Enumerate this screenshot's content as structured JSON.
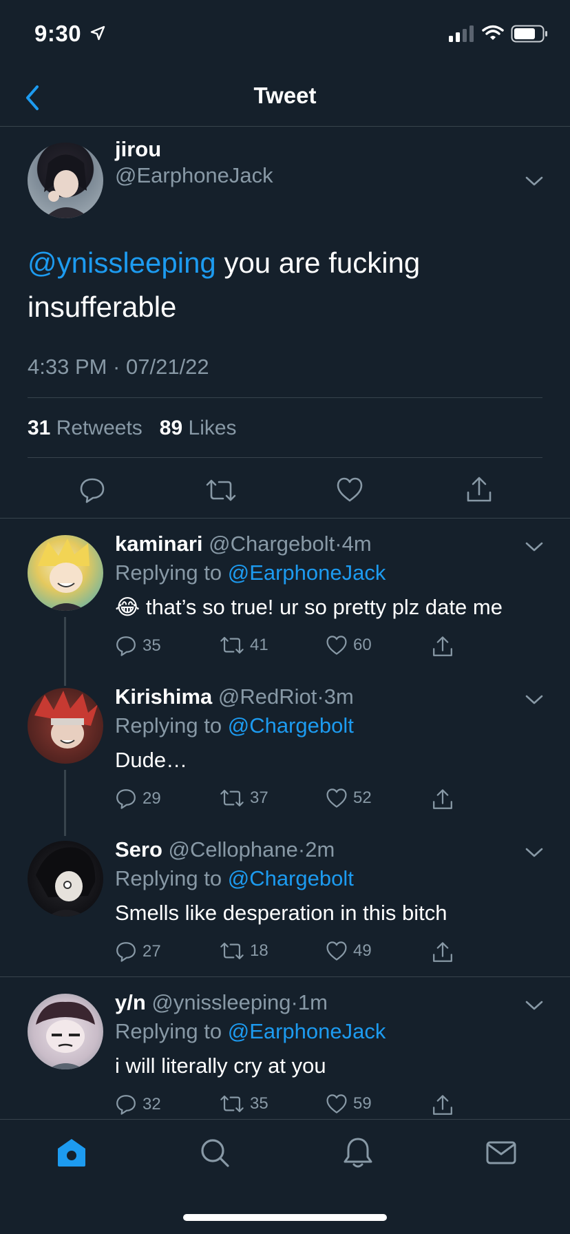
{
  "status_bar": {
    "time": "9:30"
  },
  "nav": {
    "title": "Tweet"
  },
  "tweet": {
    "author_name": "jirou",
    "author_handle": "@EarphoneJack",
    "mention": "@ynissleeping",
    "text_line1": " you are fucking",
    "text_line2": "insufferable",
    "timestamp": "4:33 PM · 07/21/22",
    "retweets_count": "31",
    "retweets_label": "Retweets",
    "likes_count": "89",
    "likes_label": "Likes"
  },
  "replies": [
    {
      "name": "kaminari",
      "handle": "@Chargebolt",
      "time": "4m",
      "replying_prefix": "Replying to ",
      "replying_to": "@EarphoneJack",
      "emoji": "😂",
      "text": "that’s so true! ur so pretty plz date me",
      "replies": "35",
      "retweets": "41",
      "likes": "60"
    },
    {
      "name": "Kirishima",
      "handle": "@RedRiot",
      "time": "3m",
      "replying_prefix": "Replying to ",
      "replying_to": "@Chargebolt",
      "text": "Dude…",
      "replies": "29",
      "retweets": "37",
      "likes": "52"
    },
    {
      "name": "Sero",
      "handle": "@Cellophane",
      "time": "2m",
      "replying_prefix": "Replying to ",
      "replying_to": "@Chargebolt",
      "text": "Smells like desperation in this bitch",
      "replies": "27",
      "retweets": "18",
      "likes": "49"
    },
    {
      "name": "y/n",
      "handle": "@ynissleeping",
      "time": "1m",
      "replying_prefix": "Replying to ",
      "replying_to": "@EarphoneJack",
      "text": "i will literally cry at you",
      "replies": "32",
      "retweets": "35",
      "likes": "59"
    }
  ],
  "tabs": [
    "home-icon",
    "search-icon",
    "notifications-icon",
    "messages-icon"
  ],
  "colors": {
    "background": "#15202b",
    "accent": "#1d9bf0",
    "muted": "#8899a6",
    "divider": "#38444d"
  }
}
